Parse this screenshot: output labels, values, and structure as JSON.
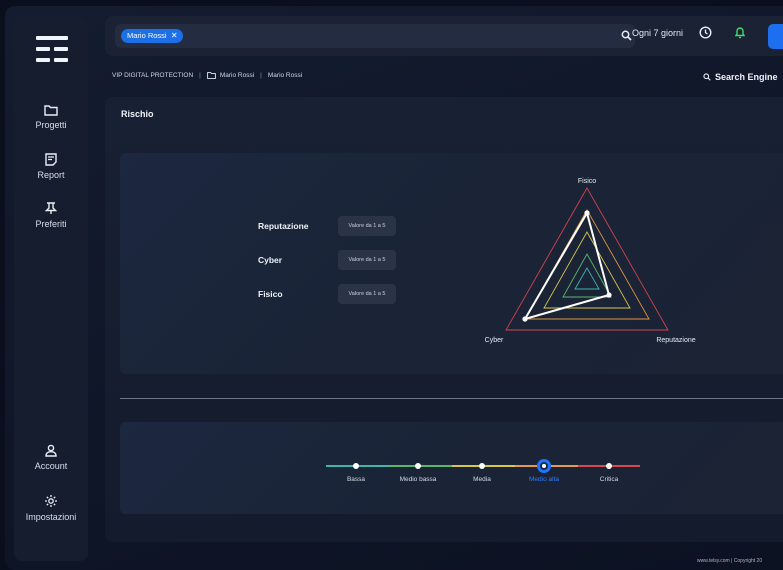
{
  "topbar": {
    "chip_label": "Mario Rossi",
    "chip_remove": "✕",
    "period_label": "Ogni 7 giorni"
  },
  "sidebar": {
    "items": [
      {
        "label": "Progetti",
        "icon": "folder-icon"
      },
      {
        "label": "Report",
        "icon": "report-icon"
      },
      {
        "label": "Preferiti",
        "icon": "pin-icon"
      },
      {
        "label": "Account",
        "icon": "user-icon"
      },
      {
        "label": "Impostazioni",
        "icon": "gear-icon"
      }
    ]
  },
  "breadcrumb": {
    "root": "VIP DIGITAL PROTECTION",
    "folder": "Mario Rossi",
    "current": "Mario Rossi"
  },
  "search_engine_label": "Search Engine",
  "panel": {
    "title": "Rischio",
    "rows": [
      {
        "label": "Reputazione",
        "placeholder": "Valore da 1 a 5"
      },
      {
        "label": "Cyber",
        "placeholder": "Valore da 1 a 5"
      },
      {
        "label": "Fisico",
        "placeholder": "Valore da 1 a 5"
      }
    ]
  },
  "radar": {
    "axes": {
      "top": "Fisico",
      "left": "Cyber",
      "right": "Reputazione"
    }
  },
  "scale": {
    "levels": [
      "Bassa",
      "Medio bassa",
      "Media",
      "Medio alta",
      "Critica"
    ],
    "selected": "Medio alta",
    "colors": [
      "#3fb6a8",
      "#58b96a",
      "#d6c64c",
      "#e59a4a",
      "#d9484a"
    ]
  },
  "footer": "www.telsy.com  |  Copyright 20",
  "colors": {
    "accent": "#1e6ff0",
    "bell": "#3ddc6a"
  }
}
